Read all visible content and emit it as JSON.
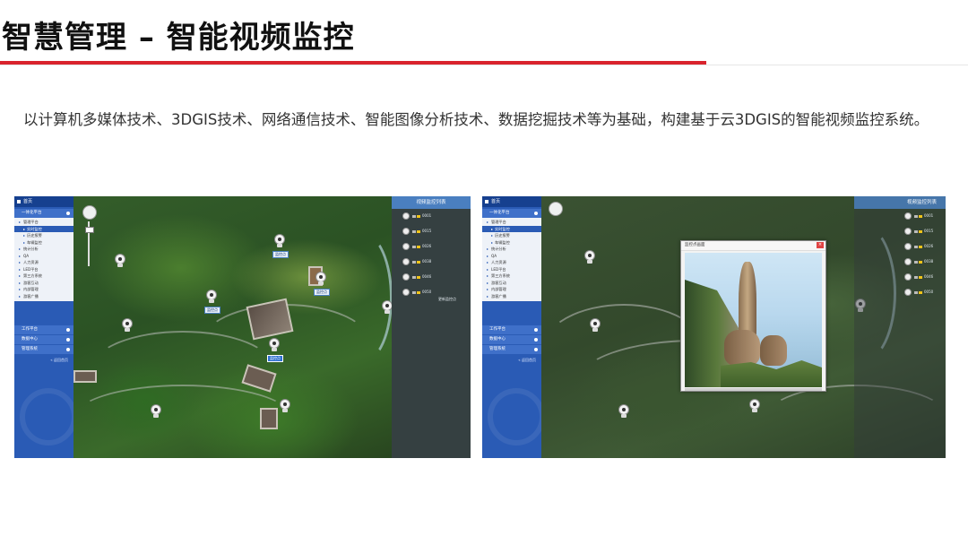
{
  "header": {
    "title": "智慧管理 – 智能视频监控",
    "description": "以计算机多媒体技术、3DGIS技术、网络通信技术、智能图像分析技术、数据挖掘技术等为基础，构建基于云3DGIS的智能视频监控系统。"
  },
  "colors": {
    "accent_bar": "#d9232d",
    "sidebar": "#2a5bb5",
    "panel_title": "#4a7fc0"
  },
  "left_screen": {
    "sidebar": {
      "home": "首页",
      "section": "一体化平台",
      "items": [
        "管理平台",
        "实时监控",
        "历史报警",
        "车辆监控",
        "统计分析",
        "QA",
        "人力资源",
        "LED平台",
        "第三方系统",
        "游客互动",
        "内部管理",
        "游客广播"
      ],
      "bottom_sections": [
        "工作平台",
        "数据中心",
        "管理系统"
      ],
      "back": "« 返回首页"
    },
    "panel": {
      "title": "视频监控列表",
      "cameras": [
        "0001",
        "0015",
        "0026",
        "0038",
        "0046",
        "0050"
      ],
      "footer": "更新监控点"
    },
    "map_tags": [
      "监控点",
      "监控点",
      "监控点",
      "监控点"
    ]
  },
  "right_screen": {
    "sidebar": {
      "home": "首页",
      "section": "一体化平台",
      "items": [
        "管理平台",
        "实时监控",
        "历史报警",
        "车辆监控",
        "统计分析",
        "QA",
        "人力资源",
        "LED平台",
        "第三方系统",
        "游客互动",
        "内部管理",
        "游客广播"
      ],
      "bottom_sections": [
        "工作平台",
        "数据中心",
        "管理系统"
      ],
      "back": "« 返回首页"
    },
    "panel": {
      "title": "视频监控列表",
      "cameras": [
        "0001",
        "0015",
        "0026",
        "0038",
        "0046",
        "0050"
      ]
    },
    "popup": {
      "title": "监控点画面",
      "close_label": "×"
    }
  }
}
